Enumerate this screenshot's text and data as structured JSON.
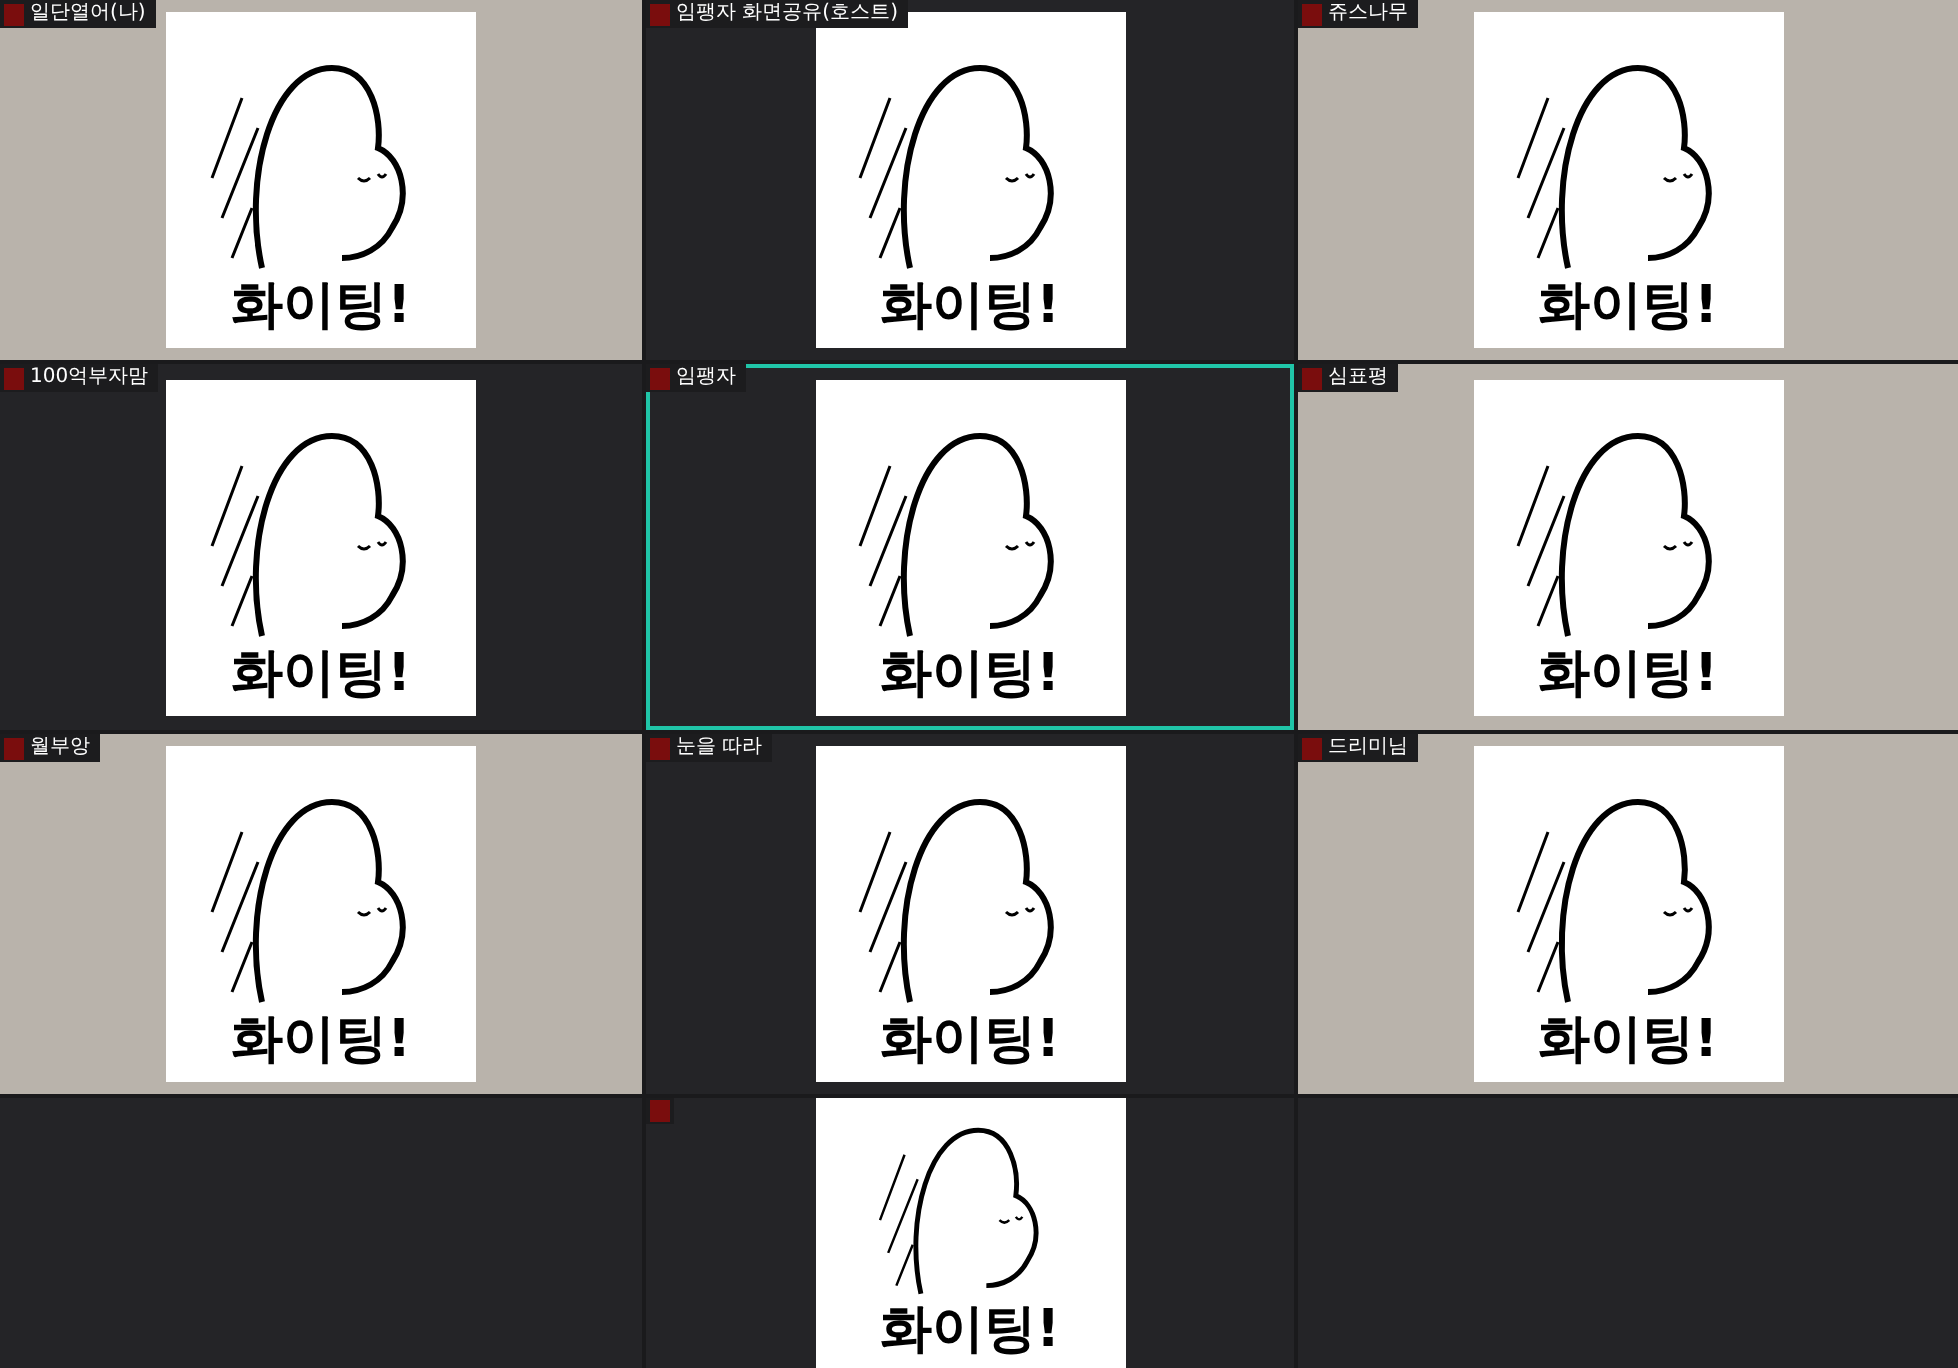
{
  "tiles": [
    {
      "name": "일단열어(나)",
      "kind": "photo",
      "active": false,
      "sticker": "화이팅!"
    },
    {
      "name": "임팽자 화면공유(호스트)",
      "kind": "off",
      "active": false,
      "sticker": "화이팅!"
    },
    {
      "name": "쥬스나무",
      "kind": "photo",
      "active": false,
      "sticker": "화이팅!"
    },
    {
      "name": "100억부자맘",
      "kind": "off",
      "active": false,
      "sticker": "화이팅!"
    },
    {
      "name": "임팽자",
      "kind": "off",
      "active": true,
      "sticker": "화이팅!"
    },
    {
      "name": "심표평",
      "kind": "photo",
      "active": false,
      "sticker": "화이팅!"
    },
    {
      "name": "월부앙",
      "kind": "photo",
      "active": false,
      "sticker": "화이팅!"
    },
    {
      "name": "눈을 따라",
      "kind": "off",
      "active": false,
      "sticker": "화이팅!"
    },
    {
      "name": "드리미님",
      "kind": "photo",
      "active": false,
      "sticker": "화이팅!"
    },
    {
      "kind": "off",
      "active": false,
      "sticker": "화이팅!"
    }
  ]
}
